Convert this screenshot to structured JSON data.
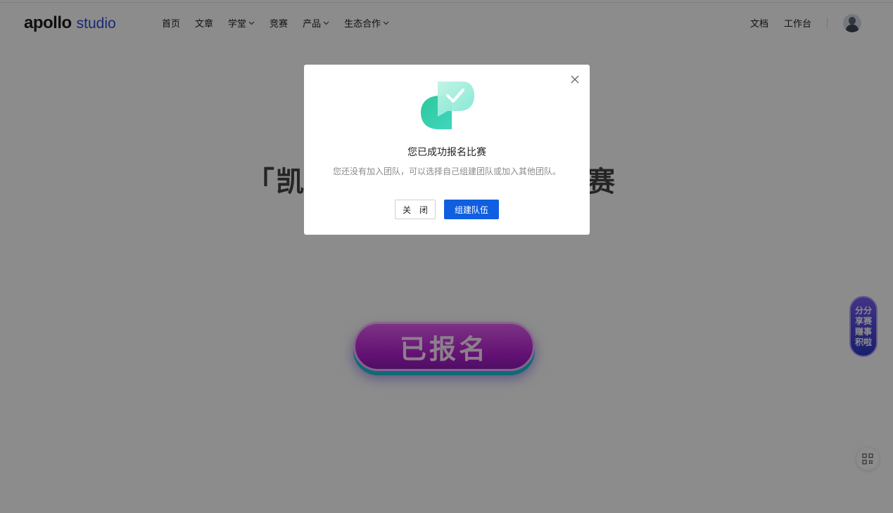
{
  "brand": {
    "main": "apollo",
    "sub": "studio",
    "accent": "#2c4bd9"
  },
  "nav": {
    "items": [
      {
        "label": "首页",
        "dropdown": false
      },
      {
        "label": "文章",
        "dropdown": false
      },
      {
        "label": "学堂",
        "dropdown": true
      },
      {
        "label": "竞赛",
        "dropdown": false
      },
      {
        "label": "产品",
        "dropdown": true
      },
      {
        "label": "生态合作",
        "dropdown": true
      }
    ],
    "right": {
      "docs": "文档",
      "workbench": "工作台"
    }
  },
  "page": {
    "title_prefix": "「凯",
    "title_suffix": "赛",
    "registered_button": "已报名"
  },
  "float": {
    "share_text": "分享赚积分赛事啦"
  },
  "modal": {
    "title": "您已成功报名比赛",
    "description": "您还没有加入团队，可以选择自己组建团队或加入其他团队。",
    "close_label": "关 闭",
    "primary_label": "组建队伍",
    "primary_color": "#0f5fe0"
  }
}
